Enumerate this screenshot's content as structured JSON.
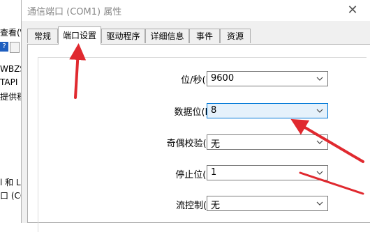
{
  "background_app": {
    "fragments": [
      "查看(\\",
      "WBZS",
      "TAPI",
      "提供程",
      "l 和 L",
      "口 (CO"
    ]
  },
  "dialog": {
    "title": "通信端口 (COM1) 属性",
    "tabs": [
      {
        "label": "常规",
        "active": false
      },
      {
        "label": "端口设置",
        "active": true
      },
      {
        "label": "驱动程序",
        "active": false
      },
      {
        "label": "详细信息",
        "active": false
      },
      {
        "label": "事件",
        "active": false
      },
      {
        "label": "资源",
        "active": false
      }
    ],
    "settings": [
      {
        "label": "位/秒(B):",
        "value": "9600"
      },
      {
        "label": "数据位(D):",
        "value": "8"
      },
      {
        "label": "奇偶校验(P):",
        "value": "无"
      },
      {
        "label": "停止位(S):",
        "value": "1"
      },
      {
        "label": "流控制(F):",
        "value": "无"
      }
    ]
  },
  "colors": {
    "arrow": "#e0292f",
    "focus_border": "#0078d7",
    "dialog_bg": "#f0f0f0"
  },
  "icons": {
    "close": "close-icon",
    "dropdown": "chevron-down-icon"
  }
}
